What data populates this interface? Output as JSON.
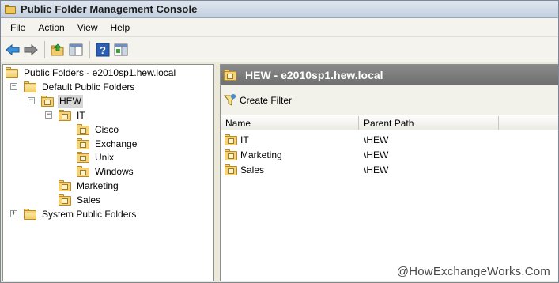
{
  "window": {
    "title": "Public Folder Management Console"
  },
  "menu": [
    "File",
    "Action",
    "View",
    "Help"
  ],
  "toolbar": {
    "buttons": [
      "back-arrow-icon",
      "forward-arrow-icon",
      "up-folder-icon",
      "show-hide-console-tree-icon",
      "help-icon",
      "show-hide-action-pane-icon"
    ]
  },
  "tree": {
    "root": "Public Folders - e2010sp1.hew.local",
    "default": "Default Public Folders",
    "hew": "HEW",
    "it": "IT",
    "cisco": "Cisco",
    "exchange": "Exchange",
    "unix": "Unix",
    "windows": "Windows",
    "marketing": "Marketing",
    "sales": "Sales",
    "system": "System Public Folders",
    "expander_minus": "−",
    "expander_plus": "+"
  },
  "content": {
    "title": "HEW - e2010sp1.hew.local",
    "action": "Create Filter",
    "columns": [
      "Name",
      "Parent Path"
    ],
    "rows": [
      {
        "name": "IT",
        "parent": "\\HEW"
      },
      {
        "name": "Marketing",
        "parent": "\\HEW"
      },
      {
        "name": "Sales",
        "parent": "\\HEW"
      }
    ]
  },
  "watermark": "@HowExchangeWorks.Com",
  "colors": {
    "header": "#7a7a7a",
    "folder": "#f4d27a",
    "selection": "#d6d6d6"
  }
}
